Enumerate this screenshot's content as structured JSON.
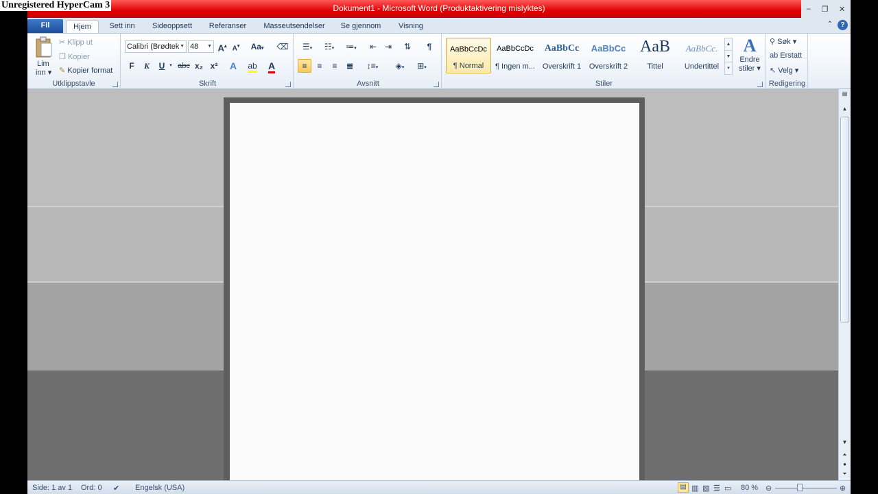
{
  "watermark": "Unregistered HyperCam 3",
  "window": {
    "title": "Dokument1  -  Microsoft Word (Produktaktivering mislyktes)",
    "controls": {
      "minimize": "–",
      "restore": "❐",
      "close": "✕"
    }
  },
  "tabs": [
    {
      "label": "Fil"
    },
    {
      "label": "Hjem"
    },
    {
      "label": "Sett inn"
    },
    {
      "label": "Sideoppsett"
    },
    {
      "label": "Referanser"
    },
    {
      "label": "Masseutsendelser"
    },
    {
      "label": "Se gjennom"
    },
    {
      "label": "Visning"
    }
  ],
  "help_label": "?",
  "minimize_ribbon": "⌃",
  "clipboard": {
    "label": "Utklippstavle",
    "paste_line1": "Lim",
    "paste_line2": "inn ▾",
    "cut": "Klipp ut",
    "copy": "Kopier",
    "format_painter": "Kopier format"
  },
  "font": {
    "label": "Skrift",
    "font_name": "Calibri (Brødtek",
    "font_size": "48",
    "grow": "A",
    "shrink": "A",
    "change_case": "Aa",
    "bold": "F",
    "italic": "K",
    "underline": "U",
    "strike": "abc",
    "subscript": "x₂",
    "superscript": "x²"
  },
  "paragraph": {
    "label": "Avsnitt",
    "pilcrow": "¶"
  },
  "styles": {
    "label": "Stiler",
    "items": [
      {
        "sample": "AaBbCcDc",
        "name": "¶ Normal"
      },
      {
        "sample": "AaBbCcDc",
        "name": "¶ Ingen m..."
      },
      {
        "sample": "AaBbCc",
        "name": "Overskrift 1"
      },
      {
        "sample": "AaBbCc",
        "name": "Overskrift 2"
      },
      {
        "sample": "AaB",
        "name": "Tittel"
      },
      {
        "sample": "AaBbCc.",
        "name": "Undertittel"
      }
    ],
    "change_styles_line1": "Endre",
    "change_styles_line2": "stiler ▾"
  },
  "editing": {
    "label": "Redigering",
    "find": "Søk ▾",
    "replace": "Erstatt",
    "select": "Velg ▾"
  },
  "status": {
    "page": "Side: 1 av 1",
    "words": "Ord: 0",
    "language": "Engelsk (USA)",
    "zoom": "80 %"
  },
  "colors": {
    "title_bar": "#e00000",
    "file_tab": "#2a5fae",
    "selected_style": "#fde9a8"
  }
}
